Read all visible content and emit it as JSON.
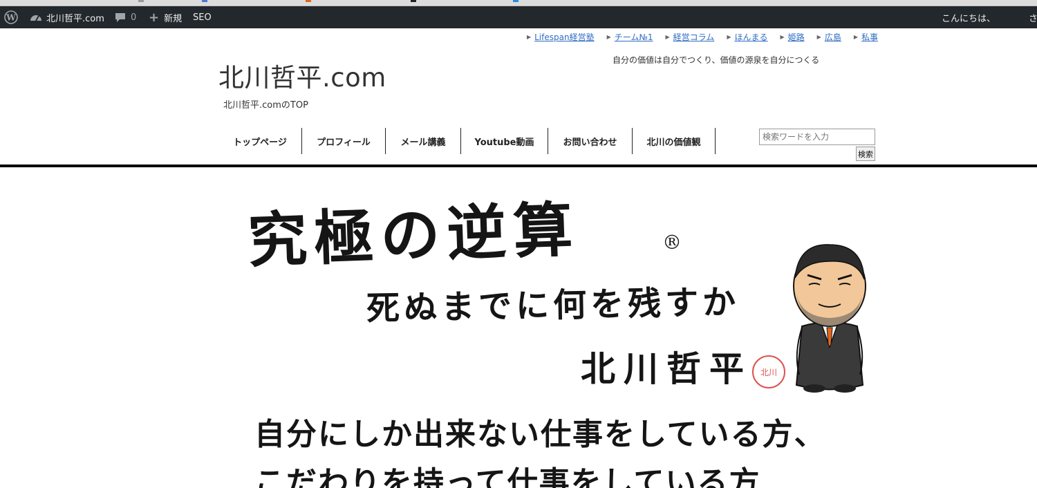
{
  "adminbar": {
    "site_name": "北川哲平.com",
    "comments_count": "0",
    "new_label": "新規",
    "seo_label": "SEO",
    "greeting": "こんにちは、",
    "greeting_tail": "さ"
  },
  "header": {
    "top_links": [
      {
        "label": "Lifespan経営塾"
      },
      {
        "label": "チーム№1"
      },
      {
        "label": "経営コラム"
      },
      {
        "label": "ほんまる"
      },
      {
        "label": "姫路"
      },
      {
        "label": "広島"
      },
      {
        "label": "私事"
      }
    ],
    "tagline": "自分の価値は自分でつくり、価値の源泉を自分につくる",
    "site_title": "北川哲平.com",
    "site_description": "北川哲平.comのTOP"
  },
  "nav": {
    "items": [
      {
        "label": "トップページ"
      },
      {
        "label": "プロフィール"
      },
      {
        "label": "メール講義"
      },
      {
        "label": "Youtube動画"
      },
      {
        "label": "お問い合わせ"
      },
      {
        "label": "北川の価値観"
      }
    ]
  },
  "search": {
    "placeholder": "検索ワードを入力",
    "button_label": "検索"
  },
  "hero": {
    "headline": "究極の逆算",
    "registered_mark": "®",
    "subheadline": "死ぬまでに何を残すか",
    "author": "北川哲平",
    "stamp_text": "北川",
    "line1": "自分にしか出来ない仕事をしている方、",
    "line2": "こだわりを持って仕事をしている方"
  },
  "colors": {
    "adminbar_bg": "#23282d",
    "link": "#2f6cc4",
    "stamp": "#d9534f"
  }
}
